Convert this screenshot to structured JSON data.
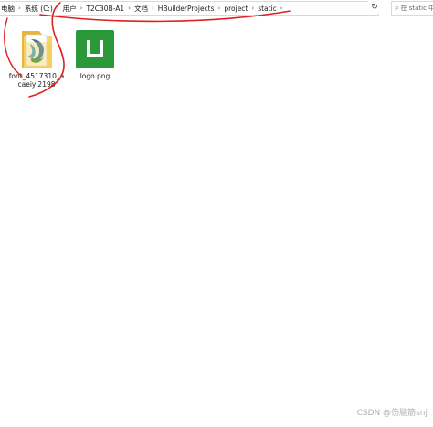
{
  "address_bar": {
    "crumbs": [
      "电脑",
      "系统 (C:)",
      "用户",
      "T2C30B-A1",
      "文档",
      "HBuilderProjects",
      "project",
      "static"
    ],
    "separator": "›",
    "dropdown_icon": "chevron-down-icon",
    "refresh_icon": "refresh-icon"
  },
  "search": {
    "placeholder": "在 static 中搜"
  },
  "files": [
    {
      "name": "font_4517310_acaeiyl2198",
      "icon": "folder-icon",
      "type": "folder"
    },
    {
      "name": "logo.png",
      "icon": "image-file-icon",
      "type": "image"
    }
  ],
  "watermark": "CSDN @伤脑筋snj",
  "colors": {
    "logo_green": "#2b9939",
    "folder_yellow": "#f3c94a",
    "annotation_red": "#e02020"
  }
}
